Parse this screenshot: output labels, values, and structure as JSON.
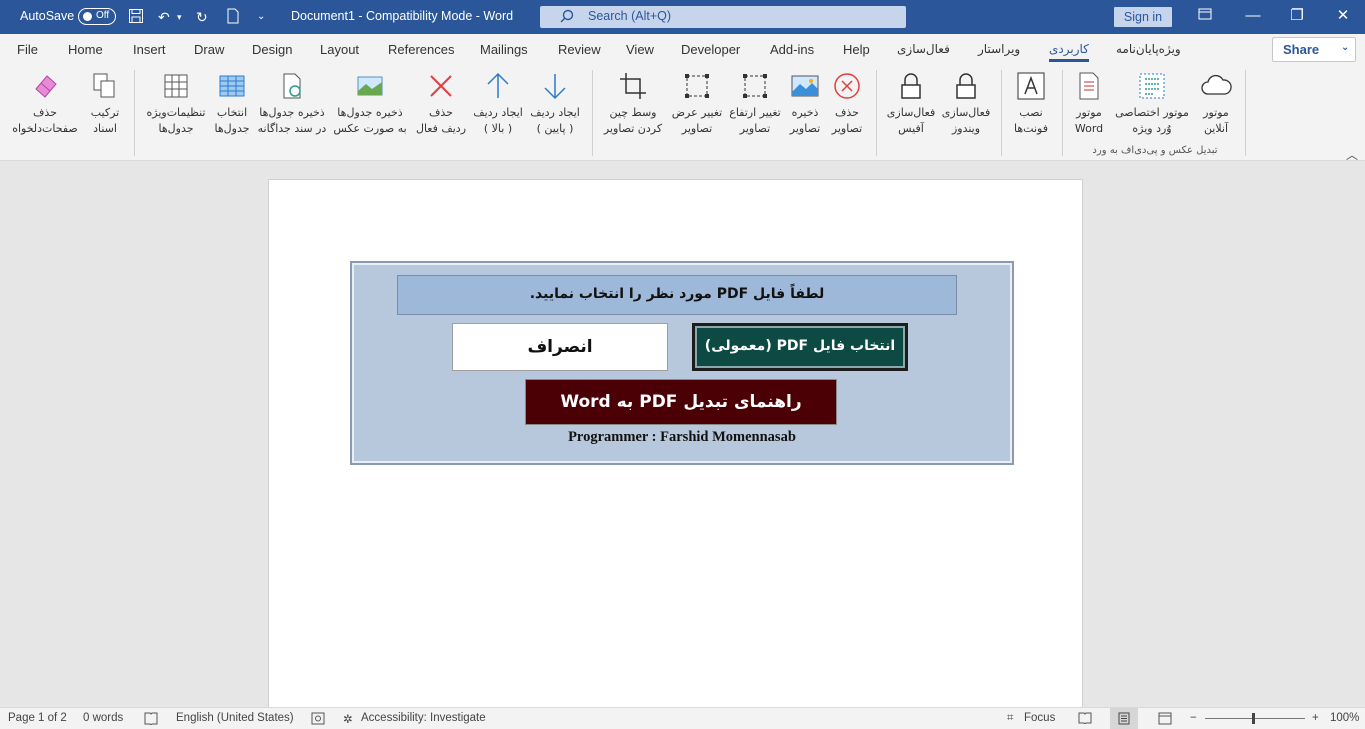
{
  "titlebar": {
    "autosave_label": "AutoSave",
    "autosave_state": "Off",
    "document_title": "Document1  -  Compatibility Mode  -  Word",
    "search_placeholder": "Search (Alt+Q)",
    "signin_label": "Sign in",
    "accent_color": "#2b579a"
  },
  "tabs": [
    {
      "label": "File"
    },
    {
      "label": "Home"
    },
    {
      "label": "Insert"
    },
    {
      "label": "Draw"
    },
    {
      "label": "Design"
    },
    {
      "label": "Layout"
    },
    {
      "label": "References"
    },
    {
      "label": "Mailings"
    },
    {
      "label": "Review"
    },
    {
      "label": "View"
    },
    {
      "label": "Developer"
    },
    {
      "label": "Add-ins"
    },
    {
      "label": "Help"
    },
    {
      "label": "فعال‌سازی"
    },
    {
      "label": "ویراستار"
    },
    {
      "label": "کاربردی",
      "active": true
    },
    {
      "label": "ویژه‌پایان‌نامه"
    }
  ],
  "share_label": "Share",
  "ribbon": {
    "buttons": [
      {
        "label": "حذف\nصفحات‌دلخواه",
        "icon": "eraser-icon"
      },
      {
        "label": "ترکیب\nاسناد",
        "icon": "combine-documents-icon"
      },
      {
        "label": "تنظیمات‌ویژه\nجدول‌ها",
        "icon": "table-settings-icon"
      },
      {
        "label": "انتخاب\nجدول‌ها",
        "icon": "table-select-icon"
      },
      {
        "label": "ذخیره جدول‌ها\nدر سند جداگانه",
        "icon": "save-table-icon"
      },
      {
        "label": "ذخیره جدول‌ها\nبه صورت عکس",
        "icon": "table-image-icon"
      },
      {
        "label": "حذف\nردیف فعال",
        "icon": "delete-row-icon"
      },
      {
        "label": "ایجاد ردیف\n( بالا )",
        "icon": "arrow-up-icon"
      },
      {
        "label": "ایجاد ردیف\n( پایین )",
        "icon": "arrow-down-icon"
      },
      {
        "label": "وسط چین\nکردن تصاویر",
        "icon": "crop-icon"
      },
      {
        "label": "تغییر عرض\nتصاویر",
        "icon": "resize-width-icon"
      },
      {
        "label": "تغییر ارتفاع\nتصاویر",
        "icon": "resize-height-icon"
      },
      {
        "label": "ذخیره\nتصاویر",
        "icon": "image-icon"
      },
      {
        "label": "حذف\nتصاویر",
        "icon": "delete-circle-icon"
      },
      {
        "label": "فعال‌سازی\nآفیس",
        "icon": "lock-icon"
      },
      {
        "label": "فعال‌سازی\nویندوز",
        "icon": "lock-icon"
      },
      {
        "label": "نصب\nفونت‌ها",
        "icon": "font-icon"
      },
      {
        "label": "موتور\nWord",
        "icon": "word-engine-icon"
      },
      {
        "label": "موتور اختصاصی\nوُرد ویژه",
        "icon": "special-engine-icon"
      },
      {
        "label": "موتور\nآنلاین",
        "icon": "cloud-icon"
      }
    ],
    "group_label": "تبدیل عکس و پی‌دی‌اف به ورد"
  },
  "dialog": {
    "prompt": "لطفاً فایل PDF مورد نظر را انتخاب نمایید.",
    "pick_button": "انتخاب فایل PDF (معمولی)",
    "cancel_button": "انصراف",
    "guide_button": "راهنمای تبدیل PDF به Word",
    "programmer": "Programmer : Farshid Momennasab",
    "colors": {
      "panel": "#b8c8dc",
      "pick": "#0d4a44",
      "guide": "#4a0004"
    }
  },
  "statusbar": {
    "page": "Page 1 of 2",
    "words": "0 words",
    "language": "English (United States)",
    "accessibility": "Accessibility: Investigate",
    "focus": "Focus",
    "zoom": "100%"
  }
}
